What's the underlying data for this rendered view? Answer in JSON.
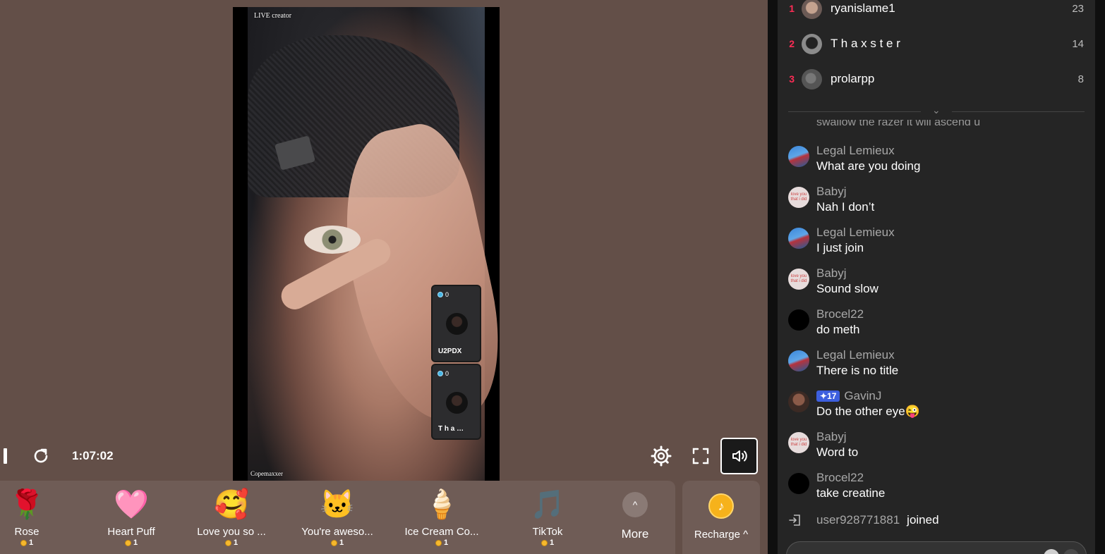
{
  "video": {
    "watermark_top": "LIVE creator",
    "watermark_bottom": "Copemaxxer",
    "guests": [
      {
        "score": "0",
        "name": "U2PDX"
      },
      {
        "score": "0",
        "name": "T h a …"
      }
    ]
  },
  "player": {
    "timer": "1:07:02"
  },
  "gifts": [
    {
      "icon": "🌹",
      "name": "Rose",
      "price": "1"
    },
    {
      "icon": "🩷",
      "name": "Heart Puff",
      "price": "1"
    },
    {
      "icon": "🥰",
      "name": "Love you so ...",
      "price": "1"
    },
    {
      "icon": "🐱",
      "name": "You're aweso...",
      "price": "1"
    },
    {
      "icon": "🍦",
      "name": "Ice Cream Co...",
      "price": "1"
    },
    {
      "icon": "🎵",
      "name": "TikTok",
      "price": "1"
    }
  ],
  "more_label": "More",
  "recharge_label": "Recharge ^",
  "leaderboard": [
    {
      "rank": "1",
      "name": "ryanislame1",
      "score": "23"
    },
    {
      "rank": "2",
      "name": "T h a x s t e r",
      "score": "14"
    },
    {
      "rank": "3",
      "name": "prolarpp",
      "score": "8"
    }
  ],
  "chat": {
    "cut_message": "swallow the razer it will ascend u",
    "messages": [
      {
        "user": "Legal Lemieux",
        "text": "What are you doing"
      },
      {
        "user": "Babyj",
        "text": "Nah I don’t"
      },
      {
        "user": "Legal Lemieux",
        "text": "I just join"
      },
      {
        "user": "Babyj",
        "text": "Sound slow"
      },
      {
        "user": "Brocel22",
        "text": "do meth"
      },
      {
        "user": "Legal Lemieux",
        "text": "There is no title"
      },
      {
        "user": "GavinJ",
        "badge": "17",
        "text": "Do the other eye😜"
      },
      {
        "user": "Babyj",
        "text": "Word to"
      },
      {
        "user": "Brocel22",
        "text": "take creatine"
      }
    ],
    "avatar_text_babyj": "love you that i did",
    "join": {
      "user": "user928771881",
      "word": "joined"
    }
  },
  "colors": {
    "accent": "#fe2c55",
    "stage_bg": "#634f48",
    "gift_bar_bg": "#6f5c56",
    "sidebar_bg": "#252525"
  }
}
